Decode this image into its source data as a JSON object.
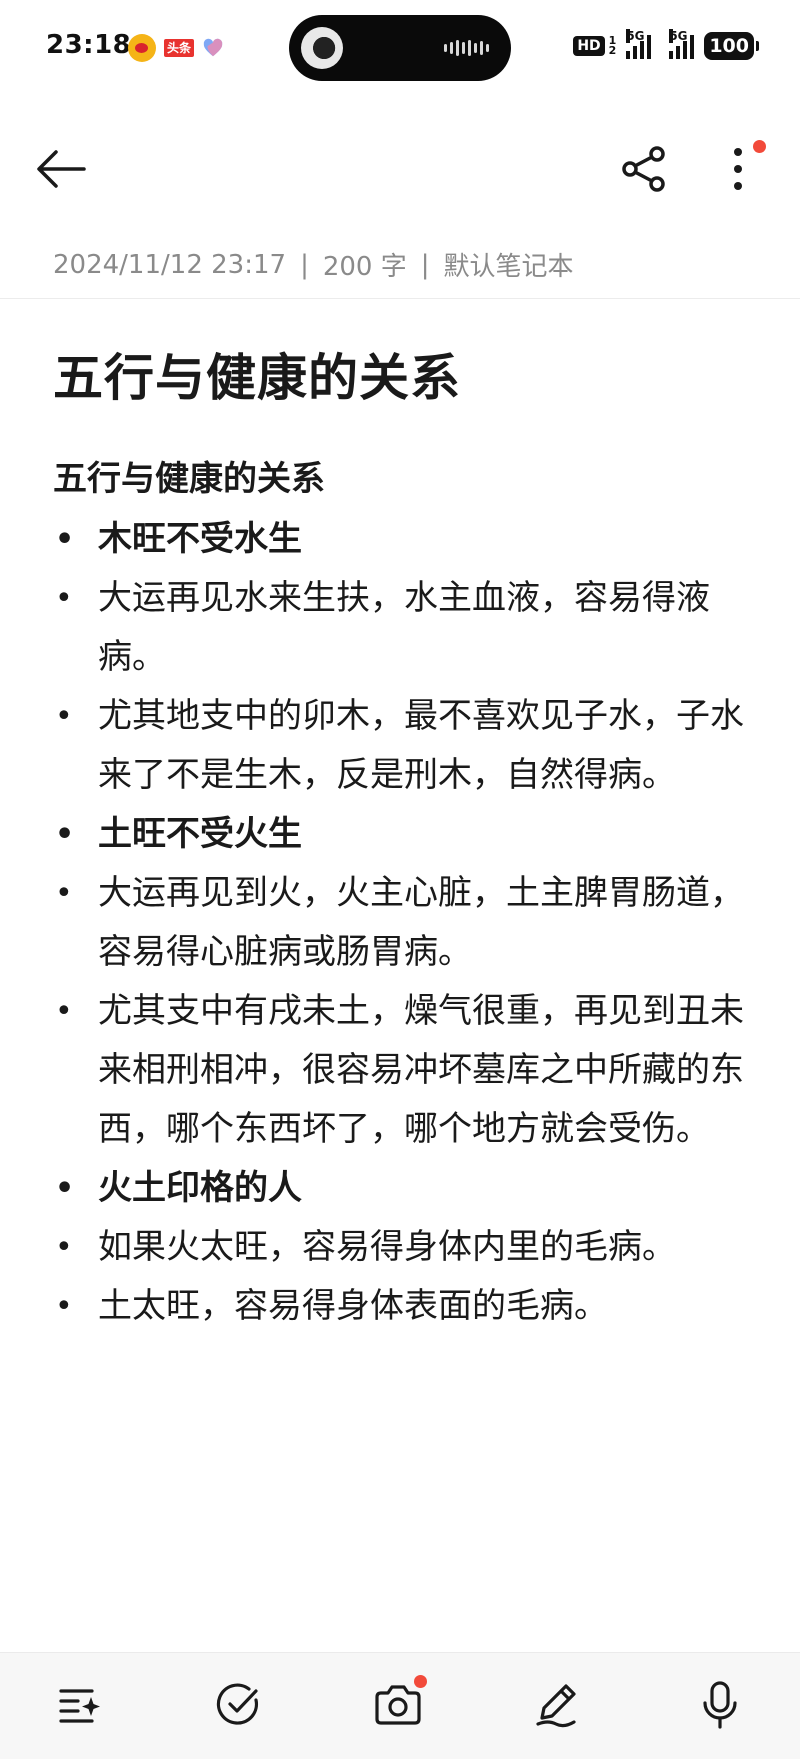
{
  "status_bar": {
    "time": "23:18",
    "toutiao_label": "头条",
    "hd_label": "HD",
    "hd_sub_top": "1",
    "hd_sub_bottom": "2",
    "signal1_label": "5G",
    "signal2_label": "5G",
    "battery": "100"
  },
  "toolbar": {
    "back_icon": "arrow-left-icon",
    "share_icon": "share-icon",
    "more_icon": "more-vertical-icon"
  },
  "meta": {
    "datetime": "2024/11/12 23:17",
    "word_count": "200 字",
    "notebook": "默认笔记本",
    "separator": "|"
  },
  "note": {
    "title": "五行与健康的关系",
    "heading": "五行与健康的关系",
    "items": [
      {
        "text": "木旺不受水生",
        "bold": true
      },
      {
        "text": "大运再见水来生扶，水主血液，容易得液病。",
        "bold": false
      },
      {
        "text": "尤其地支中的卯木，最不喜欢见子水，子水来了不是生木，反是刑木，自然得病。",
        "bold": false
      },
      {
        "text": "土旺不受火生",
        "bold": true
      },
      {
        "text": "大运再见到火，火主心脏，土主脾胃肠道，容易得心脏病或肠胃病。",
        "bold": false
      },
      {
        "text": "尤其支中有戌未土，燥气很重，再见到丑未来相刑相冲，很容易冲坏墓库之中所藏的东西，哪个东西坏了，哪个地方就会受伤。",
        "bold": false
      },
      {
        "text": "火土印格的人",
        "bold": true
      },
      {
        "text": "如果火太旺，容易得身体内里的毛病。",
        "bold": false
      },
      {
        "text": "土太旺，容易得身体表面的毛病。",
        "bold": false
      }
    ]
  },
  "bottom_bar": {
    "icons": [
      "list-ai-icon",
      "checkbox-icon",
      "camera-icon",
      "pen-icon",
      "microphone-icon"
    ]
  },
  "colors": {
    "text": "#1a1a1a",
    "meta": "#8a8a8a",
    "accent_dot": "#f24a3a",
    "bottom_bg": "#f7f7f7"
  }
}
